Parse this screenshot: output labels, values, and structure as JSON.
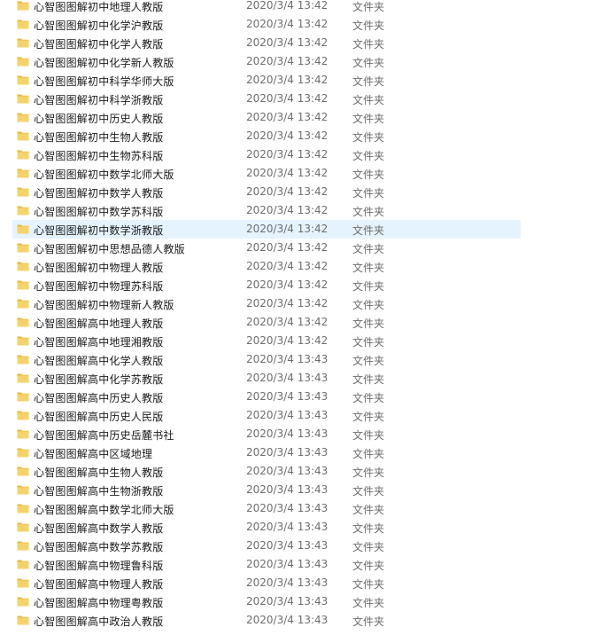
{
  "colors": {
    "folder": "#f5d36b",
    "folder_dark": "#e8b832",
    "selection": "#e5f3ff",
    "meta_text": "#6d6d6d"
  },
  "rows": [
    {
      "name": "心智图图解初中地理人教版",
      "date": "2020/3/4 13:42",
      "type": "文件夹",
      "icon": "folder-icon"
    },
    {
      "name": "心智图图解初中化学沪教版",
      "date": "2020/3/4 13:42",
      "type": "文件夹",
      "icon": "folder-icon"
    },
    {
      "name": "心智图图解初中化学人教版",
      "date": "2020/3/4 13:42",
      "type": "文件夹",
      "icon": "folder-icon"
    },
    {
      "name": "心智图图解初中化学新人教版",
      "date": "2020/3/4 13:42",
      "type": "文件夹",
      "icon": "folder-icon"
    },
    {
      "name": "心智图图解初中科学华师大版",
      "date": "2020/3/4 13:42",
      "type": "文件夹",
      "icon": "folder-icon"
    },
    {
      "name": "心智图图解初中科学浙教版",
      "date": "2020/3/4 13:42",
      "type": "文件夹",
      "icon": "folder-icon"
    },
    {
      "name": "心智图图解初中历史人教版",
      "date": "2020/3/4 13:42",
      "type": "文件夹",
      "icon": "folder-icon"
    },
    {
      "name": "心智图图解初中生物人教版",
      "date": "2020/3/4 13:42",
      "type": "文件夹",
      "icon": "folder-icon"
    },
    {
      "name": "心智图图解初中生物苏科版",
      "date": "2020/3/4 13:42",
      "type": "文件夹",
      "icon": "folder-icon"
    },
    {
      "name": "心智图图解初中数学北师大版",
      "date": "2020/3/4 13:42",
      "type": "文件夹",
      "icon": "folder-icon"
    },
    {
      "name": "心智图图解初中数学人教版",
      "date": "2020/3/4 13:42",
      "type": "文件夹",
      "icon": "folder-icon"
    },
    {
      "name": "心智图图解初中数学苏科版",
      "date": "2020/3/4 13:42",
      "type": "文件夹",
      "icon": "folder-icon"
    },
    {
      "name": "心智图图解初中数学浙教版",
      "date": "2020/3/4 13:42",
      "type": "文件夹",
      "icon": "folder-icon",
      "selected": true
    },
    {
      "name": "心智图图解初中思想品德人教版",
      "date": "2020/3/4 13:42",
      "type": "文件夹",
      "icon": "folder-icon"
    },
    {
      "name": "心智图图解初中物理人教版",
      "date": "2020/3/4 13:42",
      "type": "文件夹",
      "icon": "folder-icon"
    },
    {
      "name": "心智图图解初中物理苏科版",
      "date": "2020/3/4 13:42",
      "type": "文件夹",
      "icon": "folder-icon"
    },
    {
      "name": "心智图图解初中物理新人教版",
      "date": "2020/3/4 13:42",
      "type": "文件夹",
      "icon": "folder-icon"
    },
    {
      "name": "心智图图解高中地理人教版",
      "date": "2020/3/4 13:42",
      "type": "文件夹",
      "icon": "folder-icon"
    },
    {
      "name": "心智图图解高中地理湘教版",
      "date": "2020/3/4 13:42",
      "type": "文件夹",
      "icon": "folder-icon"
    },
    {
      "name": "心智图图解高中化学人教版",
      "date": "2020/3/4 13:43",
      "type": "文件夹",
      "icon": "folder-icon"
    },
    {
      "name": "心智图图解高中化学苏教版",
      "date": "2020/3/4 13:43",
      "type": "文件夹",
      "icon": "folder-icon"
    },
    {
      "name": "心智图图解高中历史人教版",
      "date": "2020/3/4 13:43",
      "type": "文件夹",
      "icon": "folder-icon"
    },
    {
      "name": "心智图图解高中历史人民版",
      "date": "2020/3/4 13:43",
      "type": "文件夹",
      "icon": "folder-icon"
    },
    {
      "name": "心智图图解高中历史岳麓书社",
      "date": "2020/3/4 13:43",
      "type": "文件夹",
      "icon": "folder-icon"
    },
    {
      "name": "心智图图解高中区域地理",
      "date": "2020/3/4 13:43",
      "type": "文件夹",
      "icon": "folder-icon"
    },
    {
      "name": "心智图图解高中生物人教版",
      "date": "2020/3/4 13:43",
      "type": "文件夹",
      "icon": "folder-icon"
    },
    {
      "name": "心智图图解高中生物浙教版",
      "date": "2020/3/4 13:43",
      "type": "文件夹",
      "icon": "folder-icon"
    },
    {
      "name": "心智图图解高中数学北师大版",
      "date": "2020/3/4 13:43",
      "type": "文件夹",
      "icon": "folder-icon"
    },
    {
      "name": "心智图图解高中数学人教版",
      "date": "2020/3/4 13:43",
      "type": "文件夹",
      "icon": "folder-icon"
    },
    {
      "name": "心智图图解高中数学苏教版",
      "date": "2020/3/4 13:43",
      "type": "文件夹",
      "icon": "folder-icon"
    },
    {
      "name": "心智图图解高中物理鲁科版",
      "date": "2020/3/4 13:43",
      "type": "文件夹",
      "icon": "folder-icon"
    },
    {
      "name": "心智图图解高中物理人教版",
      "date": "2020/3/4 13:43",
      "type": "文件夹",
      "icon": "folder-icon"
    },
    {
      "name": "心智图图解高中物理粤教版",
      "date": "2020/3/4 13:43",
      "type": "文件夹",
      "icon": "folder-icon"
    },
    {
      "name": "心智图图解高中政治人教版",
      "date": "2020/3/4 13:43",
      "type": "文件夹",
      "icon": "folder-icon"
    }
  ]
}
